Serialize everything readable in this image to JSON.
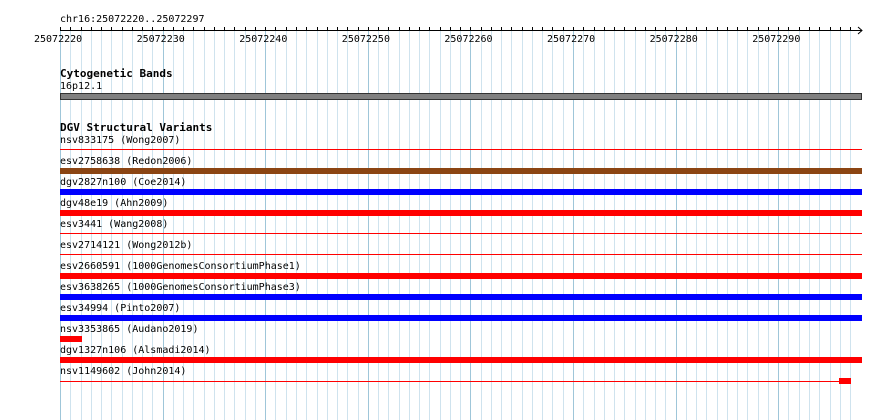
{
  "region": "chr16:25072220..25072297",
  "ruler": {
    "start": 25072220,
    "end": 25072297,
    "ticks": [
      "25072220",
      "25072230",
      "25072240",
      "25072250",
      "25072260",
      "25072270",
      "25072280",
      "25072290"
    ]
  },
  "cytoband_track": {
    "title": "Cytogenetic Bands",
    "band_label": "16p12.1",
    "band_color": "#808080"
  },
  "dgv_track": {
    "title": "DGV Structural Variants",
    "variants": [
      {
        "id": "nsv833175",
        "source": "(Wong2007)",
        "type": "none",
        "color": "#ff0000",
        "extent": "full"
      },
      {
        "id": "esv2758638",
        "source": "(Redon2006)",
        "type": "bar",
        "color": "#8b4513",
        "extent": "full"
      },
      {
        "id": "dgv2827n100",
        "source": "(Coe2014)",
        "type": "bar",
        "color": "#0000ff",
        "extent": "full"
      },
      {
        "id": "dgv48e19",
        "source": "(Ahn2009)",
        "type": "bar",
        "color": "#ff0000",
        "extent": "full"
      },
      {
        "id": "esv3441",
        "source": "(Wang2008)",
        "type": "none",
        "color": "#ff0000",
        "extent": "full"
      },
      {
        "id": "esv2714121",
        "source": "(Wong2012b)",
        "type": "none",
        "color": "#ff0000",
        "extent": "full"
      },
      {
        "id": "esv2660591",
        "source": "(1000GenomesConsortiumPhase1)",
        "type": "bar",
        "color": "#ff0000",
        "extent": "full"
      },
      {
        "id": "esv3638265",
        "source": "(1000GenomesConsortiumPhase3)",
        "type": "bar",
        "color": "#0000ff",
        "extent": "full"
      },
      {
        "id": "esv34994",
        "source": "(Pinto2007)",
        "type": "bar",
        "color": "#0000ff",
        "extent": "full"
      },
      {
        "id": "nsv3353865",
        "source": "(Audano2019)",
        "type": "bar",
        "color": "#ff0000",
        "extent": "start"
      },
      {
        "id": "dgv1327n106",
        "source": "(Alsmadi2014)",
        "type": "bar",
        "color": "#ff0000",
        "extent": "full"
      },
      {
        "id": "nsv1149602",
        "source": "(John2014)",
        "type": "line",
        "color": "#ff0000",
        "extent": "end"
      }
    ]
  }
}
